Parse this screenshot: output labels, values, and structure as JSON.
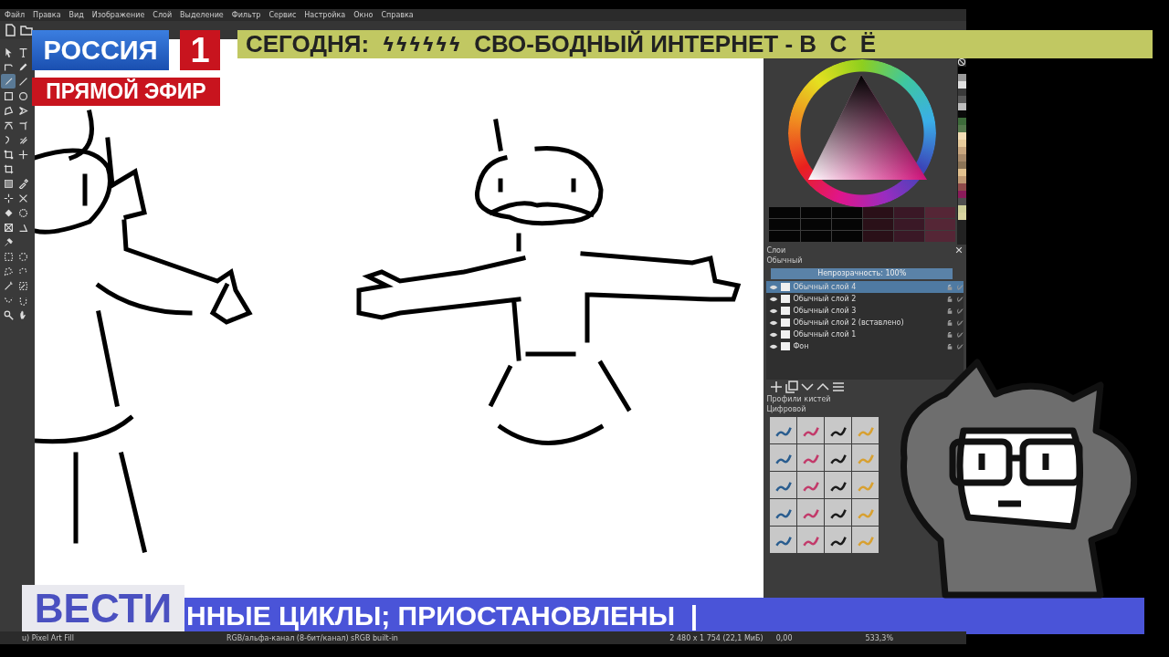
{
  "menu": [
    "Файл",
    "Правка",
    "Вид",
    "Изображение",
    "Слой",
    "Выделение",
    "Фильтр",
    "Сервис",
    "Настройка",
    "Окно",
    "Справка"
  ],
  "toolbox": {
    "tools": [
      {
        "kind": "pointer",
        "selected": false
      },
      {
        "kind": "text",
        "selected": false
      },
      {
        "kind": "shape-edit",
        "selected": false
      },
      {
        "kind": "pen",
        "selected": false
      },
      {
        "kind": "brush",
        "selected": true
      },
      {
        "kind": "line",
        "selected": false
      },
      {
        "kind": "rect",
        "selected": false
      },
      {
        "kind": "ellipse",
        "selected": false
      },
      {
        "kind": "polygon",
        "selected": false
      },
      {
        "kind": "polyline",
        "selected": false
      },
      {
        "kind": "bezier",
        "selected": false
      },
      {
        "kind": "path",
        "selected": false
      },
      {
        "kind": "curve",
        "selected": false
      },
      {
        "kind": "multibrush",
        "selected": false
      },
      {
        "kind": "transform",
        "selected": false
      },
      {
        "kind": "move",
        "selected": false
      },
      {
        "kind": "crop",
        "selected": false
      },
      {
        "kind": "gradient",
        "selected": false
      },
      {
        "kind": "eyedropper",
        "selected": false
      },
      {
        "kind": "patch",
        "selected": false
      },
      {
        "kind": "fill-assist",
        "selected": false
      },
      {
        "kind": "fill",
        "selected": false
      },
      {
        "kind": "pattern",
        "selected": false
      },
      {
        "kind": "assistant",
        "selected": false
      },
      {
        "kind": "measure",
        "selected": false
      },
      {
        "kind": "pin",
        "selected": false
      },
      {
        "kind": "rect-select",
        "selected": false
      },
      {
        "kind": "ellipse-select",
        "selected": false
      },
      {
        "kind": "poly-select",
        "selected": false
      },
      {
        "kind": "free-select",
        "selected": false
      },
      {
        "kind": "wand",
        "selected": false
      },
      {
        "kind": "color-select",
        "selected": false
      },
      {
        "kind": "bezier-select",
        "selected": false
      },
      {
        "kind": "magnetic-select",
        "selected": false
      },
      {
        "kind": "zoom",
        "selected": false
      },
      {
        "kind": "pan",
        "selected": false
      }
    ]
  },
  "palette": {
    "swatches": [
      {
        "color": "#000000"
      },
      {
        "color": "#9a9a9a"
      },
      {
        "color": "#e0e0e0"
      },
      {
        "color": "#3a3a3a"
      },
      {
        "color": "#5a5a5a"
      },
      {
        "color": "#bdbdbd"
      },
      {
        "color": "#0a0a0a"
      },
      {
        "color": "#3d6b3a"
      },
      {
        "color": "#55784c"
      },
      {
        "color": "#f2dcb5"
      },
      {
        "color": "#e8cc9c"
      },
      {
        "color": "#c9a77f"
      },
      {
        "color": "#a88a6a"
      },
      {
        "color": "#8c7456"
      },
      {
        "color": "#e3c28f"
      },
      {
        "color": "#c19a73"
      },
      {
        "color": "#8f4a4a"
      },
      {
        "color": "#8a1a5a"
      },
      {
        "color": "#4e4e4e"
      },
      {
        "color": "#cfcf9a"
      },
      {
        "color": "#d8d4a0"
      }
    ]
  },
  "layers": {
    "title": "Слои",
    "blend_mode": "Обычный",
    "opacity": {
      "label": "Непрозрачность:  100%",
      "level": 1
    },
    "items": [
      {
        "name": "Обычный слой 4",
        "selected": true
      },
      {
        "name": "Обычный слой 2",
        "selected": false
      },
      {
        "name": "Обычный слой 3",
        "selected": false
      },
      {
        "name": "Обычный слой 2 (вставлено)",
        "selected": false
      },
      {
        "name": "Обычный слой 1",
        "selected": false
      },
      {
        "name": "Фон",
        "selected": false
      }
    ]
  },
  "brushes": {
    "title": "Профили кистей",
    "tag": "Цифровой"
  },
  "status_bar": {
    "brush": "u) Pixel Art Fill",
    "color_space": "RGB/альфа-канал (8-бит/канал)  sRGB built-in",
    "size": "2 480 x 1 754 (22,1 МиБ)",
    "rotation": "0,00",
    "zoom": "533,3%"
  },
  "overlay": {
    "channel": "РОССИЯ",
    "channel_number": "1",
    "live": "ПРЯМОЙ ЭФИР",
    "headline_label": "СЕГОДНЯ:",
    "headline_symbols": "ϟϟϟϟϟϟ",
    "headline": "СВО-БОДНЫЙ ИНТЕРНЕТ - В  С  Ё",
    "program": "ВЕСТИ",
    "ticker": "ННЫЕ ЦИКЛЫ; ПРИОСТАНОВЛЕНЫ  |"
  }
}
